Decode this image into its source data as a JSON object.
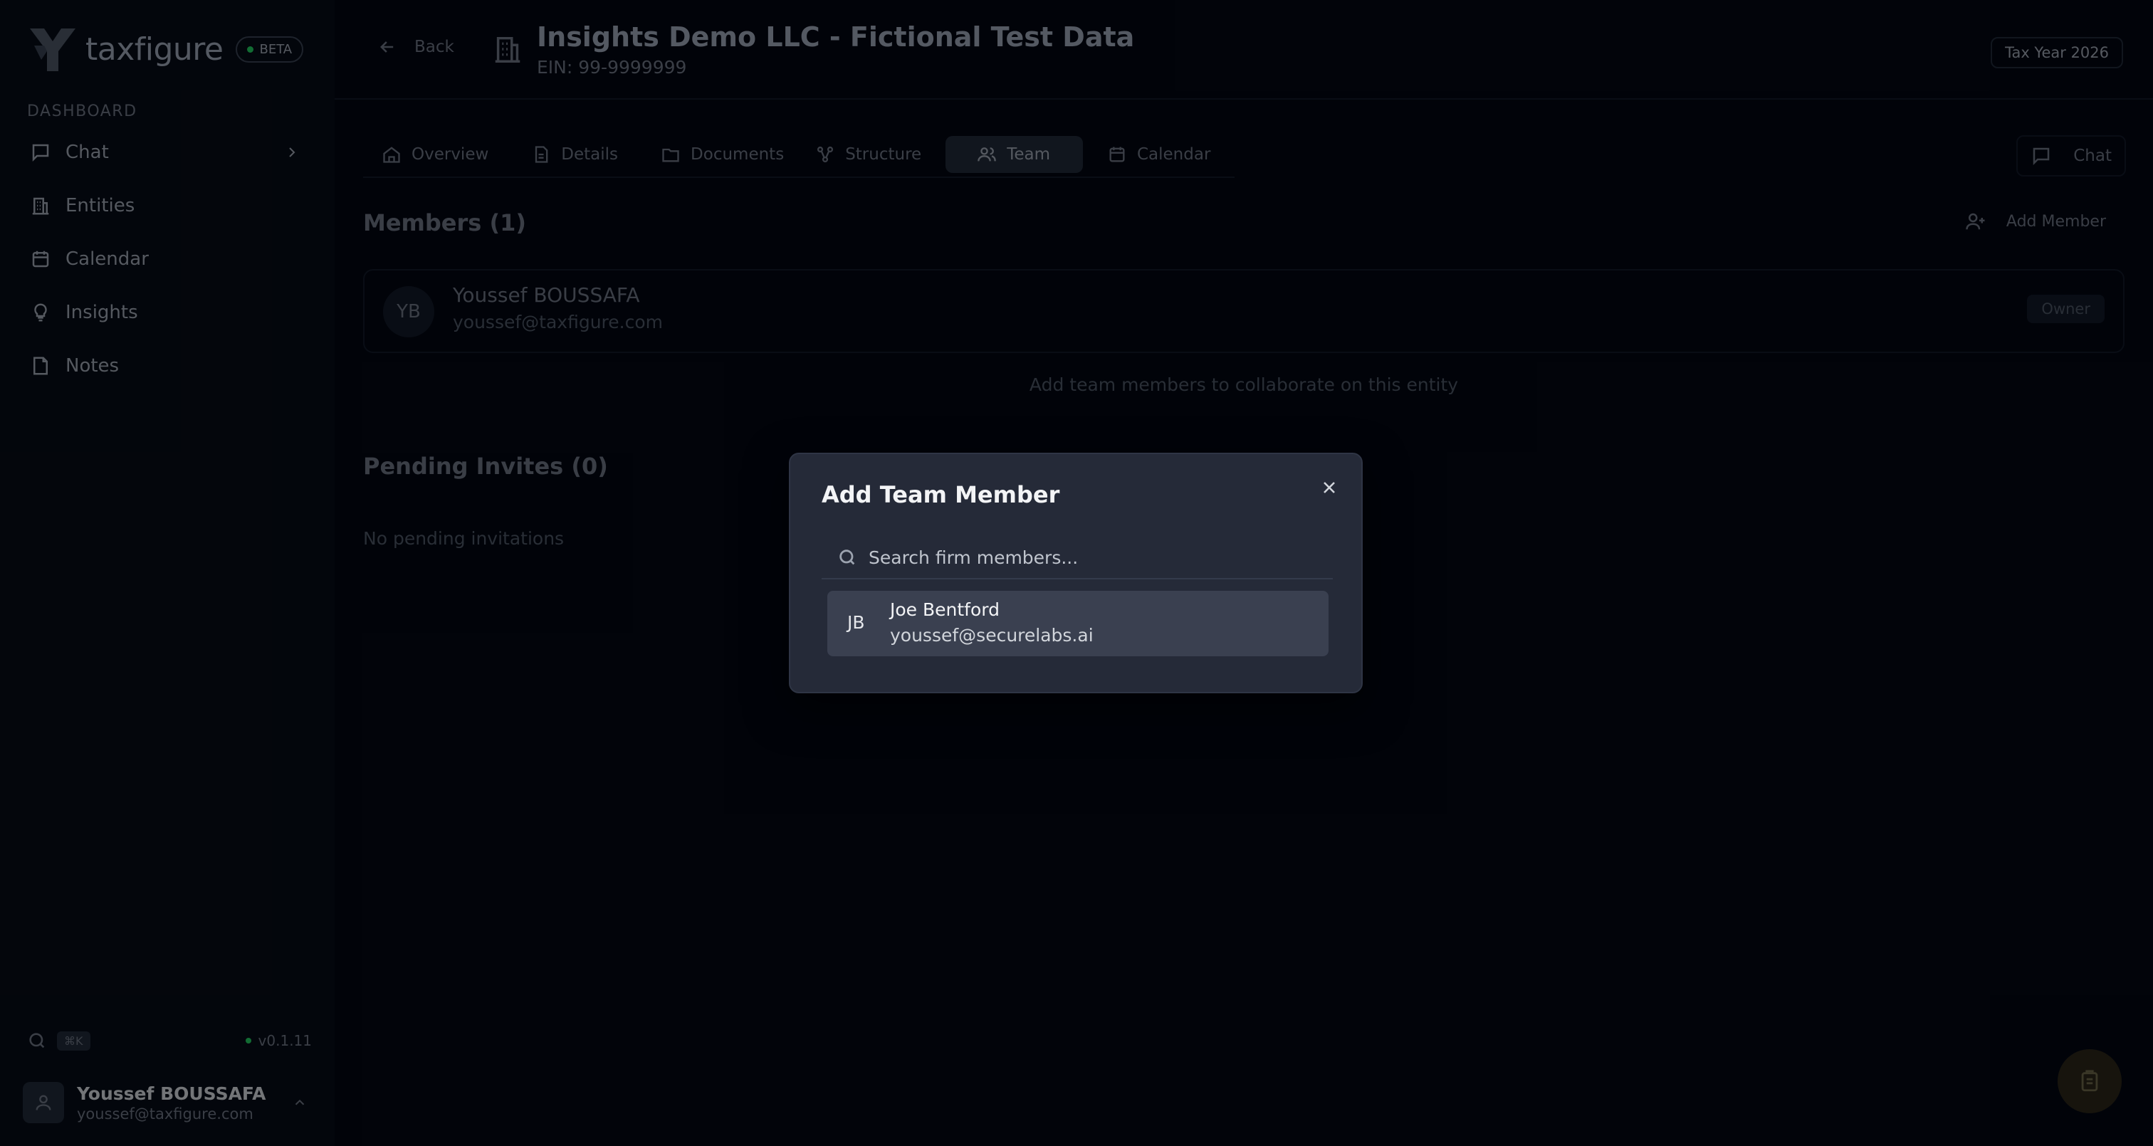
{
  "app": {
    "brand": "taxfigure",
    "beta_label": "BETA",
    "section_label": "DASHBOARD",
    "version": "v0.1.11",
    "search_shortcut": "⌘K"
  },
  "sidebar": {
    "items": [
      {
        "label": "Chat",
        "icon": "chat-icon"
      },
      {
        "label": "Entities",
        "icon": "building-icon"
      },
      {
        "label": "Calendar",
        "icon": "calendar-icon"
      },
      {
        "label": "Insights",
        "icon": "lightbulb-icon"
      },
      {
        "label": "Notes",
        "icon": "note-icon"
      }
    ]
  },
  "user": {
    "name": "Youssef BOUSSAFA",
    "email": "youssef@taxfigure.com"
  },
  "header": {
    "back_label": "Back",
    "entity_title": "Insights Demo LLC - Fictional Test Data",
    "ein": "EIN: 99-9999999",
    "tax_year": "Tax Year 2026"
  },
  "tabs": [
    {
      "label": "Overview",
      "icon": "home-icon"
    },
    {
      "label": "Details",
      "icon": "document-icon"
    },
    {
      "label": "Documents",
      "icon": "folder-icon"
    },
    {
      "label": "Structure",
      "icon": "structure-icon"
    },
    {
      "label": "Team",
      "icon": "users-icon",
      "active": true
    },
    {
      "label": "Calendar",
      "icon": "calendar-icon"
    }
  ],
  "chat_button": "Chat",
  "members": {
    "title": "Members (1)",
    "add_label": "Add Member",
    "list": [
      {
        "initials": "YB",
        "name": "Youssef BOUSSAFA",
        "email": "youssef@taxfigure.com",
        "role": "Owner"
      }
    ],
    "hint": "Add team members to collaborate on this entity"
  },
  "pending": {
    "title": "Pending Invites (0)",
    "empty": "No pending invitations"
  },
  "modal": {
    "title": "Add Team Member",
    "search_placeholder": "Search firm members...",
    "results": [
      {
        "initials": "JB",
        "name": "Joe Bentford",
        "email": "youssef@securelabs.ai"
      }
    ]
  }
}
